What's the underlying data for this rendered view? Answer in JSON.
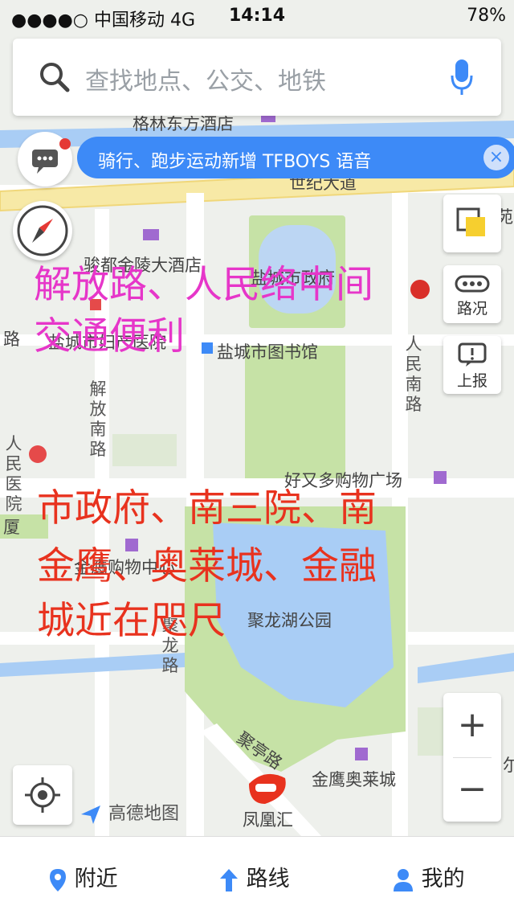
{
  "status_bar": {
    "carrier": "●●●●○ 中国移动  4G",
    "time": "14:14",
    "battery": "78%"
  },
  "search": {
    "placeholder": "查找地点、公交、地铁"
  },
  "banner": {
    "text": "骑行、跑步运动新增 TFBOYS 语音",
    "close": "×"
  },
  "map_labels": {
    "hotel_top": "格林东方酒店",
    "century_road": "世纪大道",
    "jinling_hotel": "骏都金陵大酒店",
    "gov": "盐城市政府",
    "hospital": "盐城市妇产医院",
    "library": "盐城市图书馆",
    "jiefang_road": "解放南路",
    "renmin_road": "人民南路",
    "left_road": "路",
    "people_hosp": "人民医院",
    "haoyouduo": "好又多购物广场",
    "xia": "厦",
    "shopping_center": "金鹰购物中心",
    "julong_park": "聚龙湖公园",
    "julong_road": "聚龙路",
    "juting_road": "聚亭路",
    "jinying_aolai": "金鹰奥莱城",
    "fenghuang": "凤凰汇",
    "right_edge_1": "苑",
    "right_edge_2": "尔"
  },
  "overlay_text": {
    "pink_line1": "解放路、人民络中间",
    "pink_line2": "交通便利",
    "red_line1": "市政府、南三院、南",
    "red_line2": "金鹰、奥莱城、金融",
    "red_line3": "城近在咫尺"
  },
  "right_controls": {
    "layers": "",
    "traffic": "路况",
    "report": "上报"
  },
  "zoom": {
    "plus": "+",
    "minus": "−"
  },
  "logo": {
    "text": "高德地图"
  },
  "tabs": [
    {
      "label": "附近"
    },
    {
      "label": "路线"
    },
    {
      "label": "我的"
    }
  ],
  "colors": {
    "accent": "#3d8af7",
    "park": "#c6e2a6",
    "water": "#a9cdf5"
  }
}
